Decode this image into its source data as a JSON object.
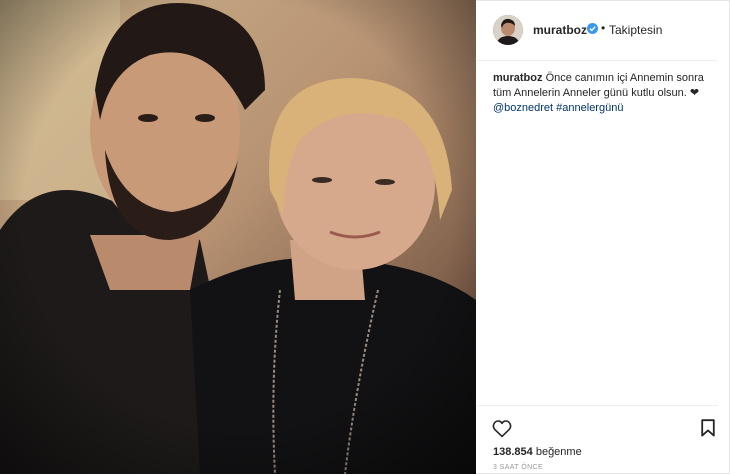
{
  "post": {
    "username": "muratboz",
    "separator": "•",
    "follow_status": "Takiptesin",
    "caption": {
      "username": "muratboz",
      "text": "Önce canımın içi Annemin sonra tüm Annelerin Anneler günü kutlu olsun. ❤",
      "mention": "@boznedret",
      "hashtag": "#annelergünü"
    },
    "likes_count": "138.854",
    "likes_label": "beğenme",
    "timestamp": "3 SAAT ÖNCE"
  },
  "icons": {
    "verified": "verified-badge-icon",
    "like": "heart-icon",
    "save": "bookmark-icon"
  },
  "colors": {
    "verified": "#3897f0",
    "link": "#003569",
    "text": "#262626",
    "muted": "#999999"
  }
}
